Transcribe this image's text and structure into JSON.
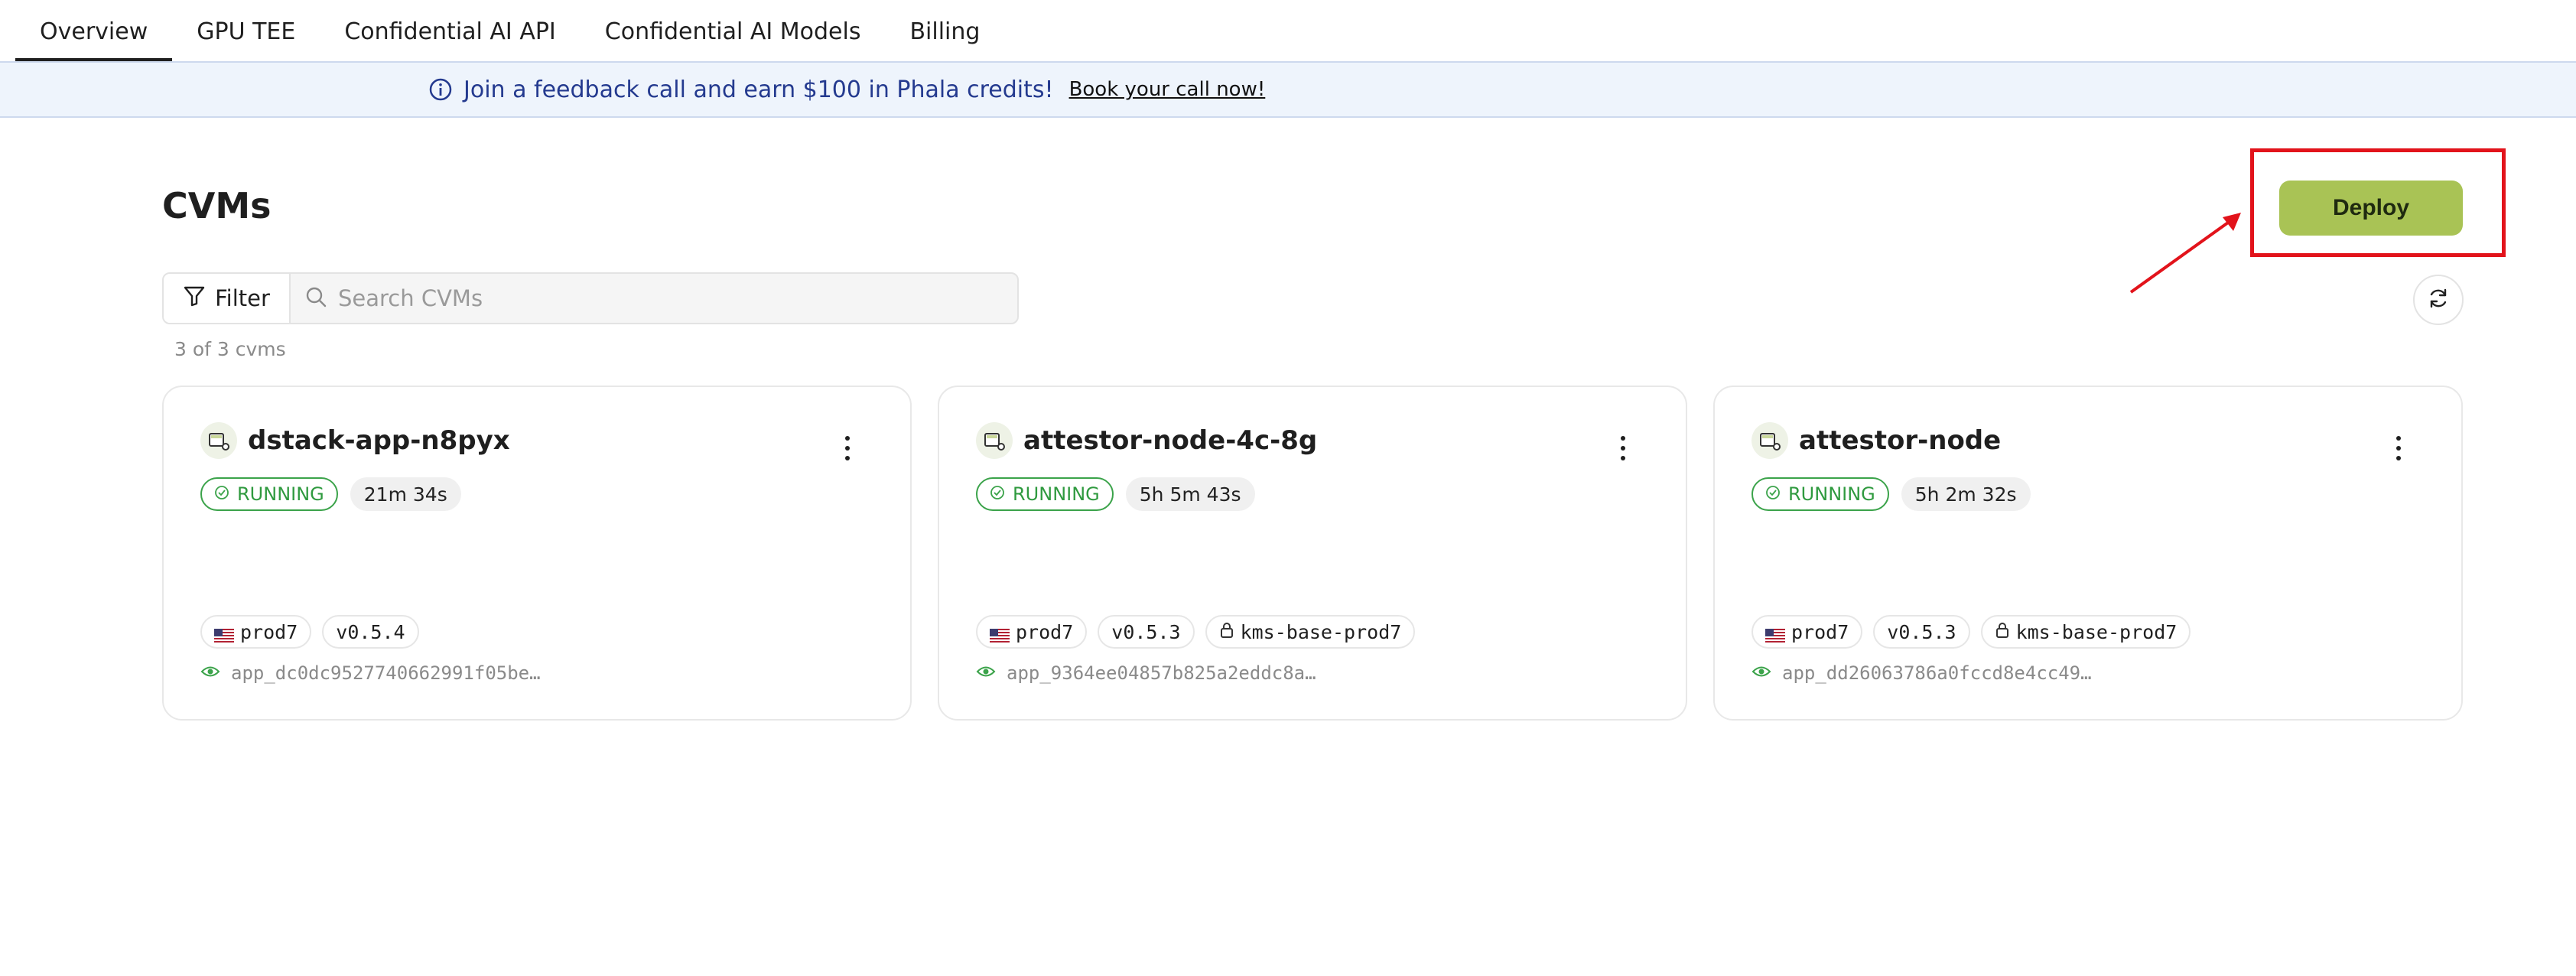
{
  "tabs": [
    {
      "label": "Overview",
      "active": true
    },
    {
      "label": "GPU TEE",
      "active": false
    },
    {
      "label": "Confidential AI API",
      "active": false
    },
    {
      "label": "Confidential AI Models",
      "active": false
    },
    {
      "label": "Billing",
      "active": false
    }
  ],
  "banner": {
    "text": "Join a feedback call and earn $100 in Phala credits!",
    "link": "Book your call now!",
    "icon": "info-icon"
  },
  "page": {
    "title": "CVMs",
    "deploy_label": "Deploy",
    "filter_label": "Filter",
    "search_placeholder": "Search CVMs",
    "count_text": "3 of 3 cvms"
  },
  "colors": {
    "accent": "#a9c355",
    "running": "#3ba34a",
    "highlight": "#e2131b",
    "banner_bg": "#eef4fc",
    "banner_text": "#243a8f"
  },
  "cvms": [
    {
      "name": "dstack-app-n8pyx",
      "status": "RUNNING",
      "uptime": "21m 34s",
      "region": "prod7",
      "version": "v0.5.4",
      "kms": "",
      "app_id": "app_dc0dc9527740662991f05be…"
    },
    {
      "name": "attestor-node-4c-8g",
      "status": "RUNNING",
      "uptime": "5h 5m 43s",
      "region": "prod7",
      "version": "v0.5.3",
      "kms": "kms-base-prod7",
      "app_id": "app_9364ee04857b825a2eddc8a…"
    },
    {
      "name": "attestor-node",
      "status": "RUNNING",
      "uptime": "5h 2m 32s",
      "region": "prod7",
      "version": "v0.5.3",
      "kms": "kms-base-prod7",
      "app_id": "app_dd26063786a0fccd8e4cc49…"
    }
  ]
}
